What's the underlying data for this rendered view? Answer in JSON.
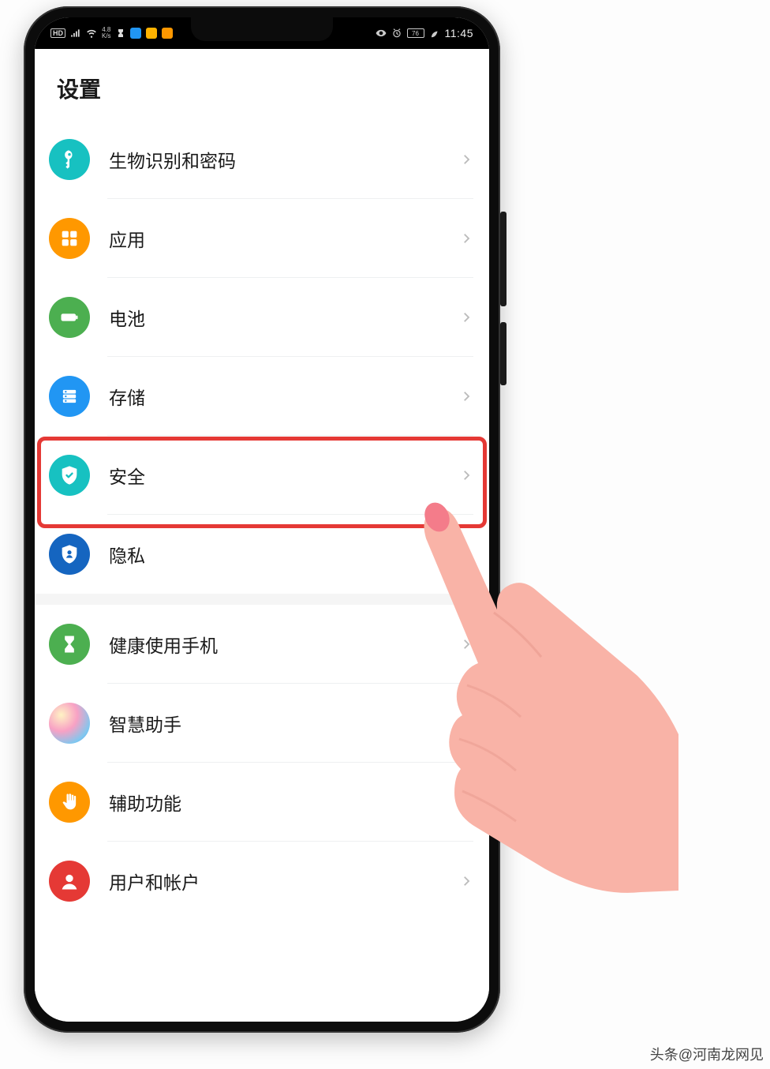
{
  "status_bar": {
    "hd_badge": "HD",
    "network_speed_top": "4.8",
    "network_speed_unit": "K/s",
    "battery_text": "76",
    "time": "11:45"
  },
  "page": {
    "title": "设置"
  },
  "groups": [
    {
      "rows": [
        {
          "id": "biometrics",
          "label": "生物识别和密码",
          "icon": "key",
          "color": "#17c1c1"
        },
        {
          "id": "apps",
          "label": "应用",
          "icon": "grid",
          "color": "#ff9800"
        },
        {
          "id": "battery",
          "label": "电池",
          "icon": "battery",
          "color": "#4caf50"
        },
        {
          "id": "storage",
          "label": "存储",
          "icon": "storage",
          "color": "#2196f3"
        },
        {
          "id": "security",
          "label": "安全",
          "icon": "shield-check",
          "color": "#17c1c1",
          "highlighted": true
        },
        {
          "id": "privacy",
          "label": "隐私",
          "icon": "privacy-shield",
          "color": "#1565c0"
        }
      ]
    },
    {
      "rows": [
        {
          "id": "digital-balance",
          "label": "健康使用手机",
          "icon": "hourglass",
          "color": "#4caf50"
        },
        {
          "id": "assistant",
          "label": "智慧助手",
          "icon": "gradient",
          "color": "gradient"
        },
        {
          "id": "accessibility",
          "label": "辅助功能",
          "icon": "hand",
          "color": "#ff9800"
        },
        {
          "id": "accounts",
          "label": "用户和帐户",
          "icon": "user",
          "color": "#e53935"
        }
      ]
    }
  ],
  "watermark": "头条@河南龙网见",
  "colors": {
    "highlight_border": "#e53935",
    "hand_fill": "#f9b3a7",
    "hand_nail": "#f47c8a"
  }
}
